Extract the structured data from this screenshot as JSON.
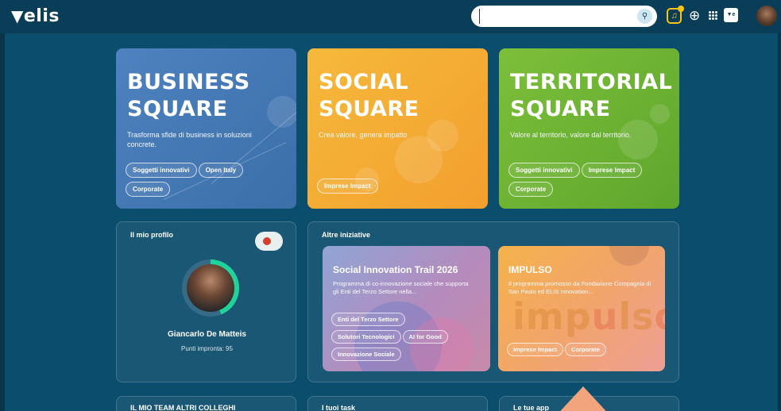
{
  "header": {
    "logo": "elis",
    "search": {
      "value": "",
      "placeholder": ""
    }
  },
  "squares": [
    {
      "title_line1": "BUSINESS",
      "title_line2": "SQUARE",
      "subtitle": "Trasforma sfide di business in soluzioni concrete.",
      "chips": [
        "Soggetti innovativi",
        "Open Italy",
        "Corporate"
      ],
      "color": "#4e82c0"
    },
    {
      "title_line1": "SOCIAL",
      "title_line2": "SQUARE",
      "subtitle": "Crea valore, genera impatto",
      "chips": [
        "Imprese Impact"
      ],
      "color": "#f6b93b"
    },
    {
      "title_line1": "TERRITORIAL",
      "title_line2": "SQUARE",
      "subtitle": "Valore al territorio, valore dal territorio.",
      "chips": [
        "Soggetti innovativi",
        "Imprese Impact",
        "Corporate"
      ],
      "color": "#7cbf3a"
    }
  ],
  "profile": {
    "title": "Il mio profilo",
    "name": "Giancarlo De Matteis",
    "points": "Punti impronta: 95",
    "progress": 0.44
  },
  "initiatives": {
    "title": "Altre iniziative",
    "items": [
      {
        "title": "Social Innovation Trail 2026",
        "description": "Programma di co-innovazione sociale che supporta gli Enti del Terzo Settore nella...",
        "chips": [
          "Enti del Terzo Settore",
          "Solutori Tecnologici",
          "AI for Good",
          "Innovazione Sociale"
        ]
      },
      {
        "title": "IMPULSO",
        "description": "Il programma promosso da Fondazione Compagnia di San Paolo ed ELIS Innovation...",
        "wordmark_a": "imp",
        "wordmark_b": "u",
        "wordmark_c": "ls",
        "wordmark_d": "o",
        "chips": [
          "Imprese Impact",
          "Corporate"
        ]
      }
    ]
  },
  "bottom_panels": [
    "IL MIO TEAM    ALTRI COLLEGHI",
    "I tuoi task",
    "Le tue app"
  ],
  "colors": {
    "background": "#0b4d6d",
    "topbar": "#0a3e58",
    "progress": "#1fd39a"
  }
}
